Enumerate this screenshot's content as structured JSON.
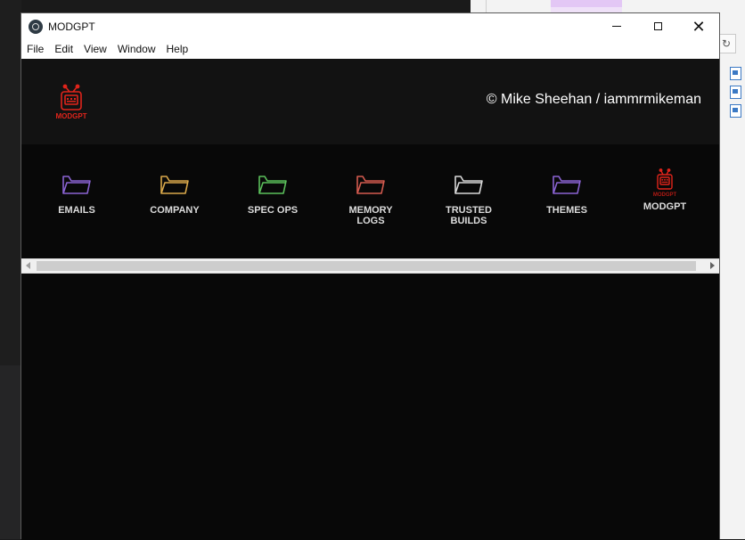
{
  "window": {
    "title": "MODGPT",
    "controls": [
      "minimize",
      "maximize",
      "close"
    ]
  },
  "menu": [
    "File",
    "Edit",
    "View",
    "Window",
    "Help"
  ],
  "header": {
    "logo_text": "MODGPT",
    "copyright": "© Mike Sheehan / iammrmikeman"
  },
  "folders": [
    {
      "label_line1": "EMAILS",
      "label_line2": "",
      "color": "#8a63d2",
      "icon": "folder-icon"
    },
    {
      "label_line1": "COMPANY",
      "label_line2": "",
      "color": "#d9a84a",
      "icon": "folder-icon"
    },
    {
      "label_line1": "SPEC OPS",
      "label_line2": "",
      "color": "#5bbf5b",
      "icon": "folder-icon"
    },
    {
      "label_line1": "MEMORY",
      "label_line2": "LOGS",
      "color": "#d45a4f",
      "icon": "folder-icon"
    },
    {
      "label_line1": "TRUSTED",
      "label_line2": "BUILDS",
      "color": "#d8d8d8",
      "icon": "folder-icon"
    },
    {
      "label_line1": "THEMES",
      "label_line2": "",
      "color": "#8a63d2",
      "icon": "folder-icon"
    },
    {
      "label_line1": "MODGPT",
      "label_line2": "",
      "color": "#e0241b",
      "icon": "robot-icon"
    }
  ],
  "colors": {
    "accent_red": "#e0241b",
    "background": "#080808",
    "header_bg": "#121212"
  }
}
